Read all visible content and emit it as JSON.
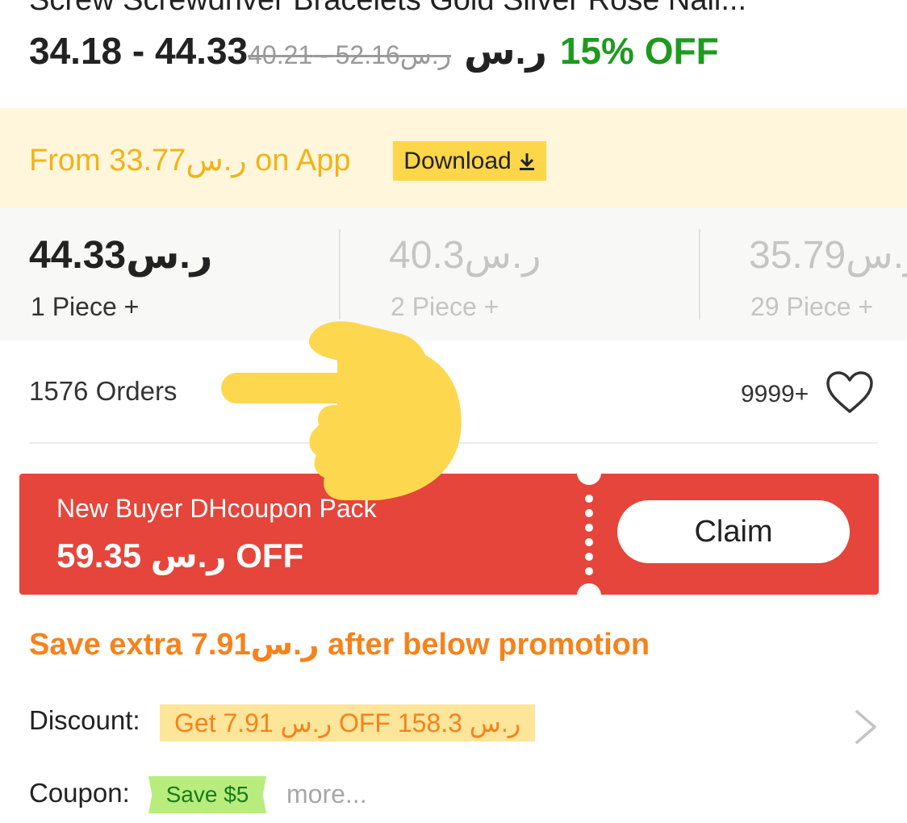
{
  "product": {
    "title": "Screw Screwdriver Bracelets Gold Silver Rose Nail...",
    "price_range": "34.18 - 44.33",
    "original_price": "ر.س52.16 - 40.21",
    "currency": "ر.س",
    "discount": "15% OFF"
  },
  "app_banner": {
    "text": "From 33.77ر.س on App",
    "download_label": "Download"
  },
  "tiers": [
    {
      "price": "44.33ر.س",
      "qty": "1 Piece +"
    },
    {
      "price": "40.3ر.س",
      "qty": "2 Piece +"
    },
    {
      "price": "35.79ر.س",
      "qty": "29 Piece +"
    }
  ],
  "stats": {
    "orders": "1576 Orders",
    "favorites": "9999+"
  },
  "coupon": {
    "title": "New Buyer DHcoupon Pack",
    "amount": "59.35 ر.س OFF",
    "claim_label": "Claim"
  },
  "promotion": {
    "headline": "Save extra 7.91ر.س after below promotion",
    "discount_label": "Discount:",
    "discount_text": "Get 7.91 ر.س OFF 158.3 ر.س",
    "coupon_label": "Coupon:",
    "coupon_tag": "Save $5",
    "more_label": "more..."
  },
  "colors": {
    "green": "#1e9a1e",
    "banner_bg": "#fff6dc",
    "banner_text": "#f2b318",
    "download_bg": "#fdd64a",
    "coupon_red": "#e5453a",
    "promo_orange": "#f7821b",
    "save_green_bg": "#b8ec7c"
  },
  "icons": [
    "download-icon",
    "heart-icon",
    "chevron-right-icon",
    "pointing-hand-icon"
  ]
}
